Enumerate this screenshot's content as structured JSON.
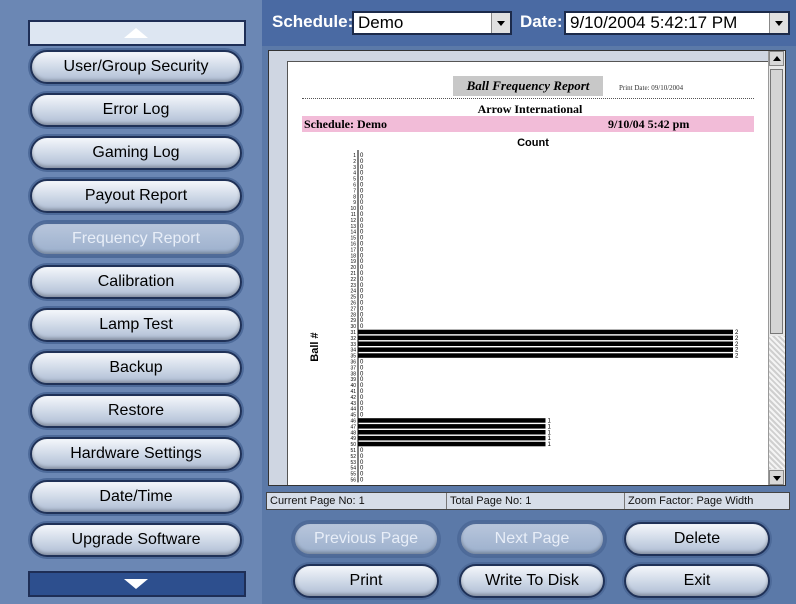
{
  "sidebar": {
    "items": [
      {
        "label": "User/Group Security",
        "enabled": true
      },
      {
        "label": "Error Log",
        "enabled": true
      },
      {
        "label": "Gaming Log",
        "enabled": true
      },
      {
        "label": "Payout Report",
        "enabled": true
      },
      {
        "label": "Frequency Report",
        "enabled": false
      },
      {
        "label": "Calibration",
        "enabled": true
      },
      {
        "label": "Lamp Test",
        "enabled": true
      },
      {
        "label": "Backup",
        "enabled": true
      },
      {
        "label": "Restore",
        "enabled": true
      },
      {
        "label": "Hardware Settings",
        "enabled": true
      },
      {
        "label": "Date/Time",
        "enabled": true
      },
      {
        "label": "Upgrade Software",
        "enabled": true
      }
    ]
  },
  "toolbar": {
    "schedule_label": "Schedule:",
    "schedule_value": "Demo",
    "date_label": "Date:",
    "date_value": "9/10/2004 5:42:17 PM"
  },
  "report": {
    "title": "Ball Frequency Report",
    "print_date": "Print Date: 09/10/2004",
    "company": "Arrow International",
    "schedule": "Schedule: Demo",
    "date": "9/10/04   5:42 pm"
  },
  "chart_data": {
    "type": "bar",
    "orientation": "horizontal",
    "title": "Count",
    "ylabel": "Ball #",
    "categories": [
      "1",
      "2",
      "3",
      "4",
      "5",
      "6",
      "7",
      "8",
      "9",
      "10",
      "11",
      "12",
      "13",
      "14",
      "15",
      "16",
      "17",
      "18",
      "19",
      "20",
      "21",
      "22",
      "23",
      "24",
      "25",
      "26",
      "27",
      "28",
      "29",
      "30",
      "31",
      "32",
      "33",
      "34",
      "35",
      "36",
      "37",
      "38",
      "39",
      "40",
      "41",
      "42",
      "43",
      "44",
      "45",
      "46",
      "47",
      "48",
      "49",
      "50",
      "51",
      "52",
      "53",
      "54",
      "55",
      "56"
    ],
    "values": [
      0,
      0,
      0,
      0,
      0,
      0,
      0,
      0,
      0,
      0,
      0,
      0,
      0,
      0,
      0,
      0,
      0,
      0,
      0,
      0,
      0,
      0,
      0,
      0,
      0,
      0,
      0,
      0,
      0,
      0,
      2,
      2,
      2,
      2,
      2,
      0,
      0,
      0,
      0,
      0,
      0,
      0,
      0,
      0,
      0,
      1,
      1,
      1,
      1,
      1,
      0,
      0,
      0,
      0,
      0,
      0
    ],
    "xlim": [
      0,
      2
    ],
    "grid": false
  },
  "status": {
    "current_page": "Current Page No: 1",
    "total_pages": "Total Page No: 1",
    "zoom": "Zoom Factor: Page Width"
  },
  "buttons": {
    "previous_page": "Previous Page",
    "next_page": "Next Page",
    "delete": "Delete",
    "print": "Print",
    "write_to_disk": "Write To Disk",
    "exit": "Exit"
  }
}
